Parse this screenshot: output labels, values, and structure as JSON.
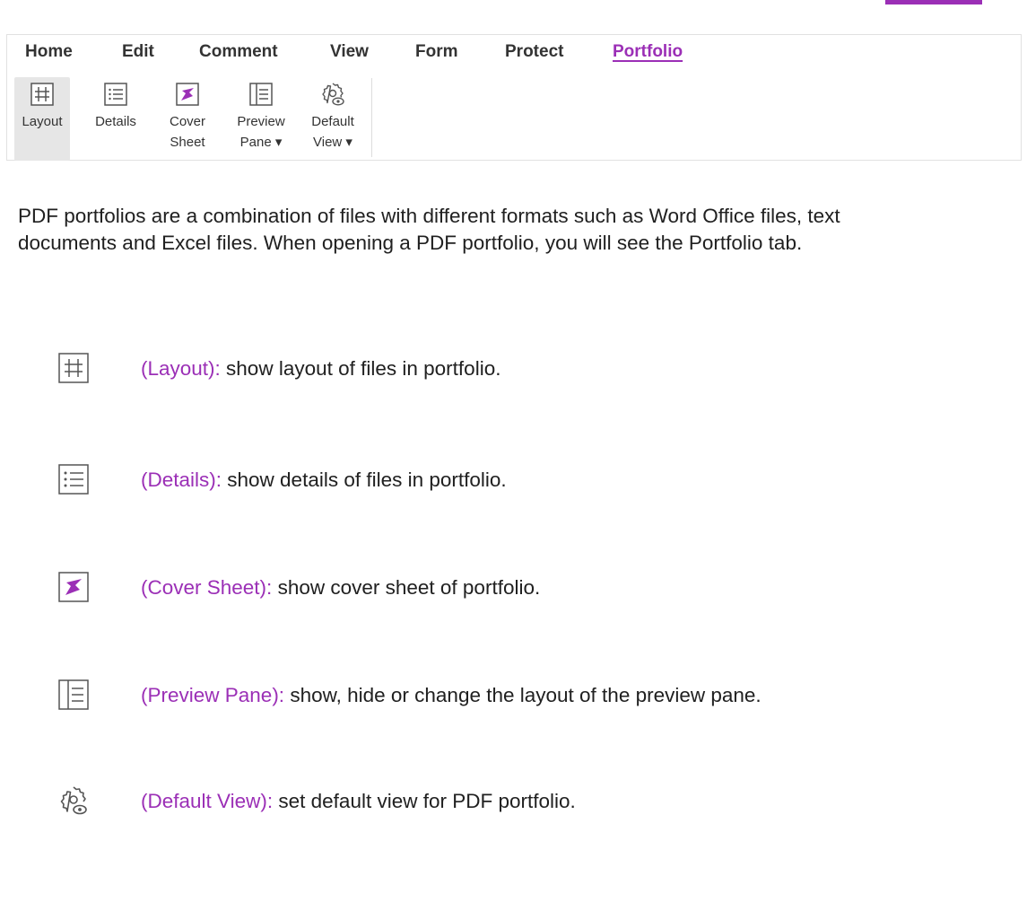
{
  "ribbon": {
    "tabs": [
      {
        "label": "Home",
        "active": false
      },
      {
        "label": "Edit",
        "active": false
      },
      {
        "label": "Comment",
        "active": false
      },
      {
        "label": "View",
        "active": false
      },
      {
        "label": "Form",
        "active": false
      },
      {
        "label": "Protect",
        "active": false
      },
      {
        "label": "Portfolio",
        "active": true
      }
    ],
    "tools": [
      {
        "label": "Layout",
        "icon": "layout-grid-icon",
        "selected": true
      },
      {
        "label": "Details",
        "icon": "details-list-icon",
        "selected": false
      },
      {
        "label": "Cover\nSheet",
        "icon": "cover-sheet-icon",
        "selected": false
      },
      {
        "label": "Preview\nPane ▾",
        "icon": "preview-pane-icon",
        "selected": false
      },
      {
        "label": "Default\nView ▾",
        "icon": "default-view-gear-icon",
        "selected": false
      }
    ]
  },
  "intro": "PDF portfolios are a combination of files with different formats such as Word Office files, text documents and Excel files. When opening a PDF portfolio, you will see the Portfolio tab.",
  "items": [
    {
      "term": "(Layout):",
      "desc": " show layout of files in portfolio.",
      "icon": "layout-grid-icon"
    },
    {
      "term": "(Details):",
      "desc": " show details of files in portfolio.",
      "icon": "details-list-icon"
    },
    {
      "term": "(Cover Sheet):",
      "desc": " show cover sheet of portfolio.",
      "icon": "cover-sheet-icon"
    },
    {
      "term": "(Preview Pane):",
      "desc": " show, hide or change the layout of the preview pane.",
      "icon": "preview-pane-icon"
    },
    {
      "term": "(Default View):",
      "desc": " set default view for PDF portfolio.",
      "icon": "default-view-gear-icon"
    }
  ],
  "colors": {
    "accent": "#9b2fb6",
    "text": "#202020",
    "selected_bg": "#e6e6e6"
  }
}
